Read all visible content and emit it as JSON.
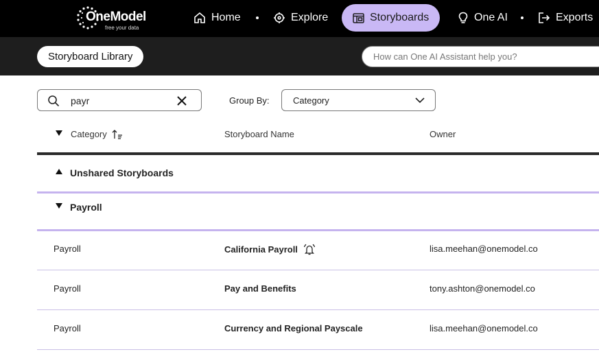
{
  "brand": {
    "name": "OneModel",
    "tagline": "free your data"
  },
  "nav": {
    "home": "Home",
    "explore": "Explore",
    "storyboards": "Storyboards",
    "one_ai": "One AI",
    "exports": "Exports"
  },
  "subheader": {
    "library_button": "Storyboard Library",
    "ai_placeholder": "How can One AI Assistant help you?"
  },
  "filters": {
    "search_value": "payr",
    "group_by_label": "Group By:",
    "group_by_value": "Category"
  },
  "table": {
    "columns": [
      "Category",
      "Storyboard Name",
      "Owner"
    ],
    "groups": [
      {
        "label": "Unshared Storyboards",
        "expanded": false
      },
      {
        "label": "Payroll",
        "expanded": true
      }
    ],
    "rows": [
      {
        "category": "Payroll",
        "name": "California Payroll",
        "owner": "lisa.meehan@onemodel.co",
        "alert_icon": "alarm-bell-icon"
      },
      {
        "category": "Payroll",
        "name": "Pay and Benefits",
        "owner": "tony.ashton@onemodel.co"
      },
      {
        "category": "Payroll",
        "name": "Currency and Regional Payscale",
        "owner": "lisa.meehan@onemodel.co"
      }
    ]
  },
  "colors": {
    "accent": "#c9b8f5",
    "nav_bg": "#000000",
    "subheader_bg": "#1e1e1e",
    "divider": "#c5b3ee"
  }
}
